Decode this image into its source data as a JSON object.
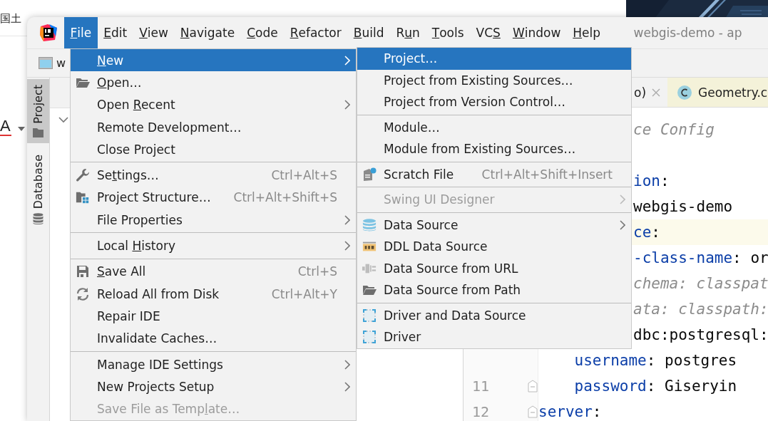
{
  "background_page": {
    "text": "国土",
    "font_color_button": "A"
  },
  "window": {
    "title": "webgis-demo - ap",
    "menubar": [
      {
        "mnemonic": "F",
        "after": "ile",
        "selected": true
      },
      {
        "mnemonic": "E",
        "after": "dit",
        "selected": false
      },
      {
        "mnemonic": "V",
        "after": "iew",
        "selected": false
      },
      {
        "mnemonic": "N",
        "after": "avigate",
        "selected": false
      },
      {
        "mnemonic": "C",
        "after": "ode",
        "selected": false
      },
      {
        "mnemonic": "R",
        "after": "efactor",
        "selected": false
      },
      {
        "mnemonic": "B",
        "after": "uild",
        "selected": false
      },
      {
        "before": "R",
        "mnemonic": "u",
        "after": "n",
        "selected": false
      },
      {
        "mnemonic": "T",
        "after": "ools",
        "selected": false
      },
      {
        "before": "VC",
        "mnemonic": "S",
        "selected": false
      },
      {
        "mnemonic": "W",
        "after": "indow",
        "selected": false
      },
      {
        "mnemonic": "H",
        "after": "elp",
        "selected": false
      }
    ],
    "toolbar": {
      "project_name": "w"
    },
    "tool_windows": [
      {
        "label": "Project",
        "selected": true
      },
      {
        "label": "Database",
        "selected": false
      }
    ],
    "editor": {
      "tabs": [
        {
          "label": "o)",
          "color": "#f2f2f2"
        },
        {
          "label": "Geometry.c",
          "color": "#f4f2d9"
        }
      ],
      "lines": [
        {
          "kind": "fragment",
          "current": false,
          "tokens": [
            {
              "kind": "comment",
              "text": "ce Config"
            }
          ]
        },
        {
          "kind": "blank",
          "current": false
        },
        {
          "kind": "fragment",
          "current": false,
          "tokens": [
            {
              "kind": "key",
              "text": "ion"
            },
            {
              "kind": "punct",
              "text": ":"
            }
          ]
        },
        {
          "kind": "fragment",
          "current": false,
          "tokens": [
            {
              "kind": "value",
              "text": "webgis-demo"
            }
          ]
        },
        {
          "kind": "fragment",
          "current": true,
          "tokens": [
            {
              "kind": "key",
              "text": "ce"
            },
            {
              "kind": "punct",
              "text": ":"
            }
          ]
        },
        {
          "kind": "fragment",
          "current": false,
          "tokens": [
            {
              "kind": "key",
              "text": "-class-name"
            },
            {
              "kind": "punct",
              "text": ": "
            },
            {
              "kind": "value",
              "text": "or"
            }
          ]
        },
        {
          "kind": "fragment",
          "current": false,
          "tokens": [
            {
              "kind": "comment",
              "text": "chema: classpat"
            }
          ]
        },
        {
          "kind": "fragment",
          "current": false,
          "tokens": [
            {
              "kind": "comment",
              "text": "ata: classpath:"
            }
          ]
        },
        {
          "kind": "fragment",
          "current": false,
          "tokens": [
            {
              "kind": "value",
              "text": "dbc:postgresql:"
            }
          ]
        },
        {
          "kind": "line",
          "current": false,
          "fold": false,
          "tokens": [
            {
              "kind": "key",
              "text": "    username"
            },
            {
              "kind": "punct",
              "text": ": "
            },
            {
              "kind": "value",
              "text": "postgres"
            }
          ]
        },
        {
          "kind": "line",
          "current": false,
          "number": "11",
          "fold": true,
          "tokens": [
            {
              "kind": "key",
              "text": "    password"
            },
            {
              "kind": "punct",
              "text": ": "
            },
            {
              "kind": "value",
              "text": "Giseryin"
            }
          ]
        },
        {
          "kind": "line",
          "current": false,
          "number": "12",
          "fold": true,
          "tokens": [
            {
              "kind": "key",
              "text": "server"
            },
            {
              "kind": "punct",
              "text": ":"
            }
          ]
        }
      ]
    }
  },
  "file_menu": [
    {
      "mnemonic": "N",
      "after": "ew",
      "submenu": true,
      "selected": true,
      "disabled": false,
      "separator_before": false
    },
    {
      "mnemonic": "O",
      "after": "pen…",
      "submenu": false,
      "selected": false,
      "disabled": false,
      "separator_before": false
    },
    {
      "before": "Open ",
      "mnemonic": "R",
      "after": "ecent",
      "submenu": true,
      "selected": false,
      "disabled": false,
      "separator_before": false
    },
    {
      "label": "Remote Development…",
      "submenu": false,
      "selected": false,
      "disabled": false,
      "separator_before": false
    },
    {
      "label": "Close Project",
      "submenu": false,
      "selected": false,
      "disabled": false,
      "separator_before": false
    },
    {
      "before": "Se",
      "mnemonic": "t",
      "after": "tings…",
      "shortcut": "Ctrl+Alt+S",
      "submenu": false,
      "selected": false,
      "disabled": false,
      "separator_before": true
    },
    {
      "label": "Project Structure…",
      "shortcut": "Ctrl+Alt+Shift+S",
      "submenu": false,
      "selected": false,
      "disabled": false,
      "separator_before": false
    },
    {
      "label": "File Properties",
      "submenu": true,
      "selected": false,
      "disabled": false,
      "separator_before": false
    },
    {
      "before": "Local ",
      "mnemonic": "H",
      "after": "istory",
      "submenu": true,
      "selected": false,
      "disabled": false,
      "separator_before": true
    },
    {
      "mnemonic": "S",
      "after": "ave All",
      "shortcut": "Ctrl+S",
      "submenu": false,
      "selected": false,
      "disabled": false,
      "separator_before": true
    },
    {
      "label": "Reload All from Disk",
      "shortcut": "Ctrl+Alt+Y",
      "submenu": false,
      "selected": false,
      "disabled": false,
      "separator_before": false
    },
    {
      "label": "Repair IDE",
      "submenu": false,
      "selected": false,
      "disabled": false,
      "separator_before": false
    },
    {
      "label": "Invalidate Caches…",
      "submenu": false,
      "selected": false,
      "disabled": false,
      "separator_before": false
    },
    {
      "label": "Manage IDE Settings",
      "submenu": true,
      "selected": false,
      "disabled": false,
      "separator_before": true
    },
    {
      "label": "New Projects Setup",
      "submenu": true,
      "selected": false,
      "disabled": false,
      "separator_before": false
    },
    {
      "before": "Save File as Temp",
      "mnemonic": "l",
      "after": "ate…",
      "submenu": false,
      "selected": false,
      "disabled": true,
      "separator_before": false
    }
  ],
  "new_submenu": [
    {
      "label": "Project…",
      "submenu": false,
      "selected": true,
      "disabled": false,
      "separator_before": false
    },
    {
      "label": "Project from Existing Sources…",
      "submenu": false,
      "selected": false,
      "disabled": false,
      "separator_before": false
    },
    {
      "label": "Project from Version Control…",
      "submenu": false,
      "selected": false,
      "disabled": false,
      "separator_before": false
    },
    {
      "label": "Module…",
      "submenu": false,
      "selected": false,
      "disabled": false,
      "separator_before": true
    },
    {
      "label": "Module from Existing Sources…",
      "submenu": false,
      "selected": false,
      "disabled": false,
      "separator_before": false
    },
    {
      "label": "Scratch File",
      "shortcut": "Ctrl+Alt+Shift+Insert",
      "submenu": false,
      "selected": false,
      "disabled": false,
      "separator_before": true
    },
    {
      "label": "Swing UI Designer",
      "submenu": true,
      "selected": false,
      "disabled": true,
      "separator_before": true
    },
    {
      "label": "Data Source",
      "submenu": true,
      "selected": false,
      "disabled": false,
      "separator_before": true
    },
    {
      "label": "DDL Data Source",
      "submenu": false,
      "selected": false,
      "disabled": false,
      "separator_before": false
    },
    {
      "label": "Data Source from URL",
      "submenu": false,
      "selected": false,
      "disabled": false,
      "separator_before": false
    },
    {
      "label": "Data Source from Path",
      "submenu": false,
      "selected": false,
      "disabled": false,
      "separator_before": false
    },
    {
      "label": "Driver and Data Source",
      "submenu": false,
      "selected": false,
      "disabled": false,
      "separator_before": true
    },
    {
      "label": "Driver",
      "submenu": false,
      "selected": false,
      "disabled": false,
      "separator_before": false
    }
  ]
}
